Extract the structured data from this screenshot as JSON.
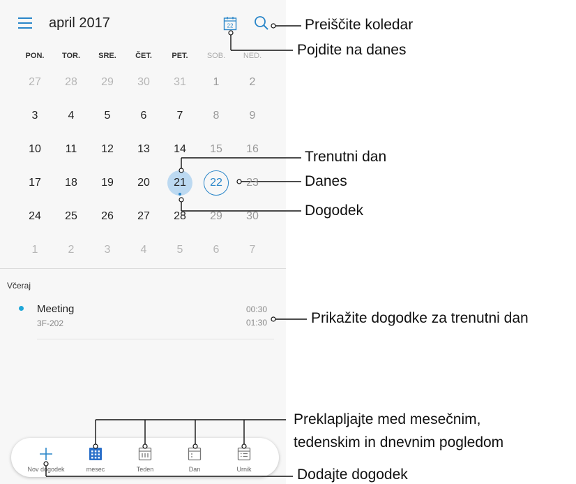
{
  "header": {
    "title": "april 2017",
    "today_icon_text": "22",
    "accent": "#2a86c9"
  },
  "weekdays": [
    "PON.",
    "TOR.",
    "SRE.",
    "ČET.",
    "PET.",
    "SOB.",
    "NED."
  ],
  "month": {
    "rows": [
      [
        "27",
        "28",
        "29",
        "30",
        "31",
        "1",
        "2"
      ],
      [
        "3",
        "4",
        "5",
        "6",
        "7",
        "8",
        "9"
      ],
      [
        "10",
        "11",
        "12",
        "13",
        "14",
        "15",
        "16"
      ],
      [
        "17",
        "18",
        "19",
        "20",
        "21",
        "22",
        "23"
      ],
      [
        "24",
        "25",
        "26",
        "27",
        "28",
        "29",
        "30"
      ],
      [
        "1",
        "2",
        "3",
        "4",
        "5",
        "6",
        "7"
      ]
    ],
    "current_day": "21",
    "today": "22"
  },
  "events_section": {
    "label": "Včeraj",
    "events": [
      {
        "title": "Meeting",
        "location": "3F-202",
        "start": "00:30",
        "end": "01:30",
        "color": "#1fa7d8"
      }
    ]
  },
  "bottom_nav": {
    "items": [
      {
        "label": "Nov dogodek",
        "icon": "plus-icon"
      },
      {
        "label": "mesec",
        "icon": "month-grid-icon"
      },
      {
        "label": "Teden",
        "icon": "week-icon"
      },
      {
        "label": "Dan",
        "icon": "day-icon"
      },
      {
        "label": "Urnik",
        "icon": "agenda-icon"
      }
    ]
  },
  "callouts": {
    "search": "Preiščite koledar",
    "go_today": "Pojdite na danes",
    "current_day": "Trenutni dan",
    "today": "Danes",
    "event": "Dogodek",
    "show_events": "Prikažite dogodke za trenutni dan",
    "switch_line1": "Preklapljajte med mesečnim,",
    "switch_line2": "tedenskim in dnevnim pogledom",
    "add_event": "Dodajte dogodek"
  }
}
